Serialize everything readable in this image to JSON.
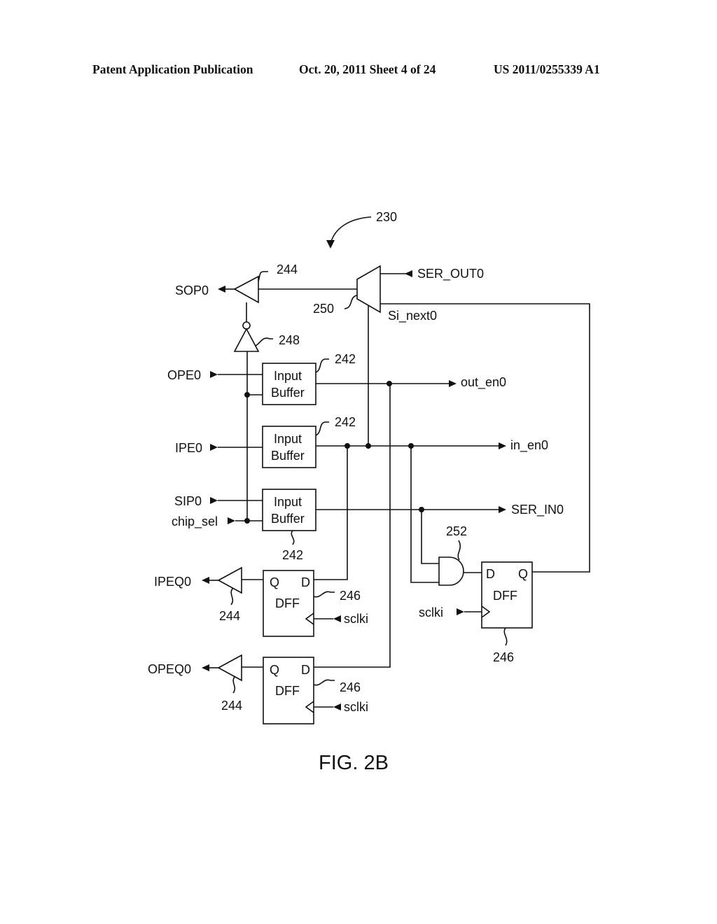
{
  "header": {
    "left": "Patent Application Publication",
    "middle": "Oct. 20, 2011   Sheet 4 of 24",
    "right": "US 2011/0255339 A1"
  },
  "figure": {
    "caption": "FIG. 2B",
    "reference_number": "230"
  },
  "inputs": {
    "ope0": "OPE0",
    "ipe0": "IPE0",
    "sip0": "SIP0",
    "chip_sel": "chip_sel",
    "ser_out0": "SER_OUT0",
    "sclki": "sclki"
  },
  "outputs": {
    "sop0": "SOP0",
    "out_en0": "out_en0",
    "in_en0": "in_en0",
    "ser_in0": "SER_IN0",
    "ipeq0": "IPEQ0",
    "opeq0": "OPEQ0"
  },
  "signals": {
    "si_next0": "Si_next0"
  },
  "blocks": {
    "input_buffer_line1": "Input",
    "input_buffer_line2": "Buffer",
    "dff": "DFF",
    "pin_d": "D",
    "pin_q": "Q"
  },
  "ref_numbers": {
    "buffer_244": "244",
    "inverter_248": "248",
    "mux_250": "250",
    "input_buffer_242": "242",
    "dff_246": "246",
    "and_gate_252": "252"
  }
}
